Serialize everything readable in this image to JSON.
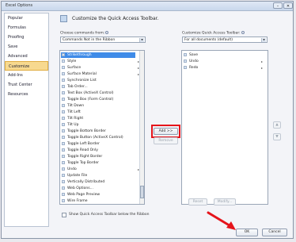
{
  "window": {
    "title": "Excel Options",
    "minimize": "–",
    "close": "✕"
  },
  "nav": {
    "items": [
      {
        "label": "Popular"
      },
      {
        "label": "Formulas"
      },
      {
        "label": "Proofing"
      },
      {
        "label": "Save"
      },
      {
        "label": "Advanced"
      },
      {
        "label": "Customize"
      },
      {
        "label": "Add-Ins"
      },
      {
        "label": "Trust Center"
      },
      {
        "label": "Resources"
      }
    ],
    "active_index": 5
  },
  "header": {
    "text": "Customize the Quick Access Toolbar."
  },
  "left": {
    "label": "Choose commands from:",
    "combo_value": "Commands Not in the Ribbon",
    "commands": [
      {
        "label": "Strikethrough"
      },
      {
        "label": "Style"
      },
      {
        "label": "Surface"
      },
      {
        "label": "Surface Material"
      },
      {
        "label": "Synchronize List"
      },
      {
        "label": "Tab Order..."
      },
      {
        "label": "Text Box (ActiveX Control)"
      },
      {
        "label": "Toggle Box (Form Control)"
      },
      {
        "label": "Tilt Down"
      },
      {
        "label": "Tilt Left"
      },
      {
        "label": "Tilt Right"
      },
      {
        "label": "Tilt Up"
      },
      {
        "label": "Toggle Bottom Border"
      },
      {
        "label": "Toggle Button (ActiveX Control)"
      },
      {
        "label": "Toggle Left Border"
      },
      {
        "label": "Toggle Read Only"
      },
      {
        "label": "Toggle Right Border"
      },
      {
        "label": "Toggle Top Border"
      },
      {
        "label": "Undo"
      },
      {
        "label": "Update File"
      },
      {
        "label": "Vertically Distributed"
      },
      {
        "label": "Web Options..."
      },
      {
        "label": "Web Page Preview"
      },
      {
        "label": "Wire Frame"
      }
    ]
  },
  "right": {
    "label": "Customize Quick Access Toolbar:",
    "combo_value": "For all documents (default)",
    "items": [
      {
        "label": "Save"
      },
      {
        "label": "Undo"
      },
      {
        "label": "Redo"
      }
    ]
  },
  "buttons": {
    "add": "Add >>",
    "remove": "Remove",
    "reset": "Reset",
    "modify": "Modify...",
    "ok": "OK",
    "cancel": "Cancel",
    "move_up": "▲",
    "move_down": "▼"
  },
  "checkbox": {
    "label": "Show Quick Access Toolbar below the Ribbon"
  },
  "colors": {
    "highlight": "#e5141b",
    "selection": "#3f8be8",
    "active_nav": "#f7d98f"
  }
}
